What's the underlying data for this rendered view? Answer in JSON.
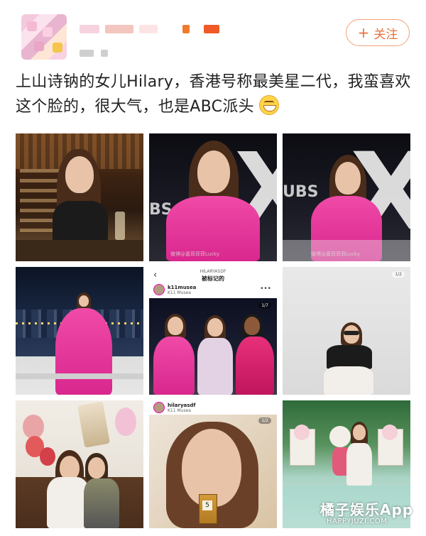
{
  "header": {
    "follow_plus": "+",
    "follow_label": "关注"
  },
  "post": {
    "text": "上山诗钠的女儿Hilary，香港号称最美星二代，我蛮喜欢这个脸的，很大气，也是ABC派头",
    "emoji": "grinning-face-emoji"
  },
  "photos": [
    {
      "id": "photo-1",
      "desc": "bar"
    },
    {
      "id": "photo-2",
      "overlay": "UBS",
      "watermark": "微博@嘉菲菲菲Lucky"
    },
    {
      "id": "photo-3",
      "overlay": "UBS",
      "watermark": "微博@嘉菲菲菲Lucky"
    },
    {
      "id": "photo-4"
    },
    {
      "id": "photo-5",
      "ig": {
        "header_small": "HILARYASDF",
        "header": "被标记的",
        "user": "k11musea",
        "location": "K11 Musea",
        "page": "1/7"
      }
    },
    {
      "id": "photo-6",
      "page": "1/2"
    },
    {
      "id": "photo-7"
    },
    {
      "id": "photo-8",
      "ig": {
        "user": "hilaryasdf",
        "location": "K11 Musea",
        "page": "1/2"
      },
      "perfume_number": "5"
    },
    {
      "id": "photo-9"
    }
  ],
  "watermark": {
    "brand": "橘子娱乐App",
    "url": "HAPPYJUZI.COM"
  },
  "colors": {
    "accent_orange": "#e8703c",
    "dress_pink": "#f04aa8"
  }
}
